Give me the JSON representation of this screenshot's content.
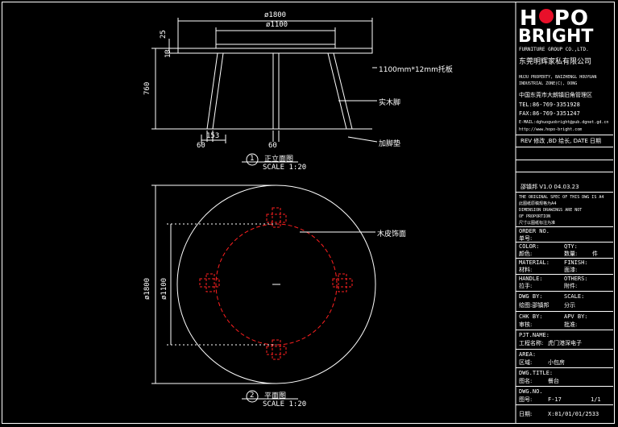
{
  "elevation": {
    "dims": {
      "outer_width": "ø1800",
      "inner_width": "ø1100",
      "top_thickness": "25",
      "top_t2": "13",
      "height": "760",
      "foot_offset": "153",
      "foot_size_left": "60",
      "foot_size_mid": "60"
    },
    "callouts": {
      "top_board": "1100mm*12mm托板",
      "leg": "实木脚",
      "foot_pad": "加脚垫"
    },
    "title_number": "1",
    "title": "正立面图",
    "scale": "SCALE 1:20"
  },
  "plan": {
    "dims": {
      "outer_dia": "ø1800",
      "inner_dia": "ø1100"
    },
    "callouts": {
      "veneer": "木皮饰面"
    },
    "title_number": "2",
    "title": "平面图",
    "scale": "SCALE 1:20"
  },
  "colors": {
    "line": "#ffffff",
    "hidden": "#ff2020",
    "logo_dot": "#e8102a"
  },
  "title_block": {
    "logo_left": "H",
    "logo_right": "PO",
    "logo_line2": "BRIGHT",
    "group": "FURNITURE GROUP CO.,LTD.",
    "company_cn": "东莞明辉家私有限公司",
    "addr1": "HUJU PROPERTY, BAIZHENGL HOUYUAN",
    "addr2": "INDUSTRIAL ZONE(C), DONG",
    "addr_cn": "中国东莞市大朗镇旧角管理区",
    "tel": "TEL:86-769-3351928",
    "fax": "FAX:86-769-3351247",
    "email": "E-MAIL:dghuoguobright@pub.dgnet.gd.cn",
    "web": "http://www.hopo-bright.com",
    "rev_header": "REV 修改 ,BD 绘长, DATE 日期",
    "rev_row": "邵镇邦   V1.0   04.03.23",
    "note1": "THE ORIGINAL SPEC OF THIS DWG IS A4",
    "note2": "此图纸原稿规格为A4",
    "note3": "DIMENSION DRAWINGS ARE NOT",
    "note4": "OF PROPORTION",
    "note5": "尺寸以图纸标注为准",
    "order_no_label": "ORDER NO.",
    "order_no_cn": "单号:",
    "color_label": "COLOR:",
    "color_cn": "颜色:",
    "qty_label": "QTY:",
    "qty_cn": "数量:",
    "qty_val": "件",
    "material_label": "MATERIAL:",
    "material_cn": "材料:",
    "finish_label": "FINISH:",
    "finish_cn": "面漆:",
    "handle_label": "HANDLE:",
    "handle_cn": "拉手:",
    "other_label": "OTHERS:",
    "other_cn": "附件:",
    "dwg_by_label": "DWG BY:",
    "dwg_by": "绘图:邵镇邦",
    "scale_label": "SCALE:",
    "scale_cn": "比例: 1:20",
    "scale_val": "分示",
    "chk_label": "CHK BY:",
    "chk_cn": "审核:",
    "apv_label": "APV BY:",
    "apv_cn": "批准:",
    "pjt_label": "PJT.NAME:",
    "pjt_cn": "工程名称:",
    "pjt_val": "虎门港深电子",
    "area_label": "AREA:",
    "area_cn": "区域:",
    "area_val": "小包房",
    "dwg_title_label": "DWG.TITLE:",
    "dwg_title_cn": "图名:",
    "dwg_title_val": "餐台",
    "dwg_no_label": "DWG.NO.",
    "dwg_no_cn": "图号:",
    "dwg_no_val": "F-17",
    "sheet": "1/1",
    "date_label": "日期:",
    "date_val": "X:01/01/01/2533"
  }
}
